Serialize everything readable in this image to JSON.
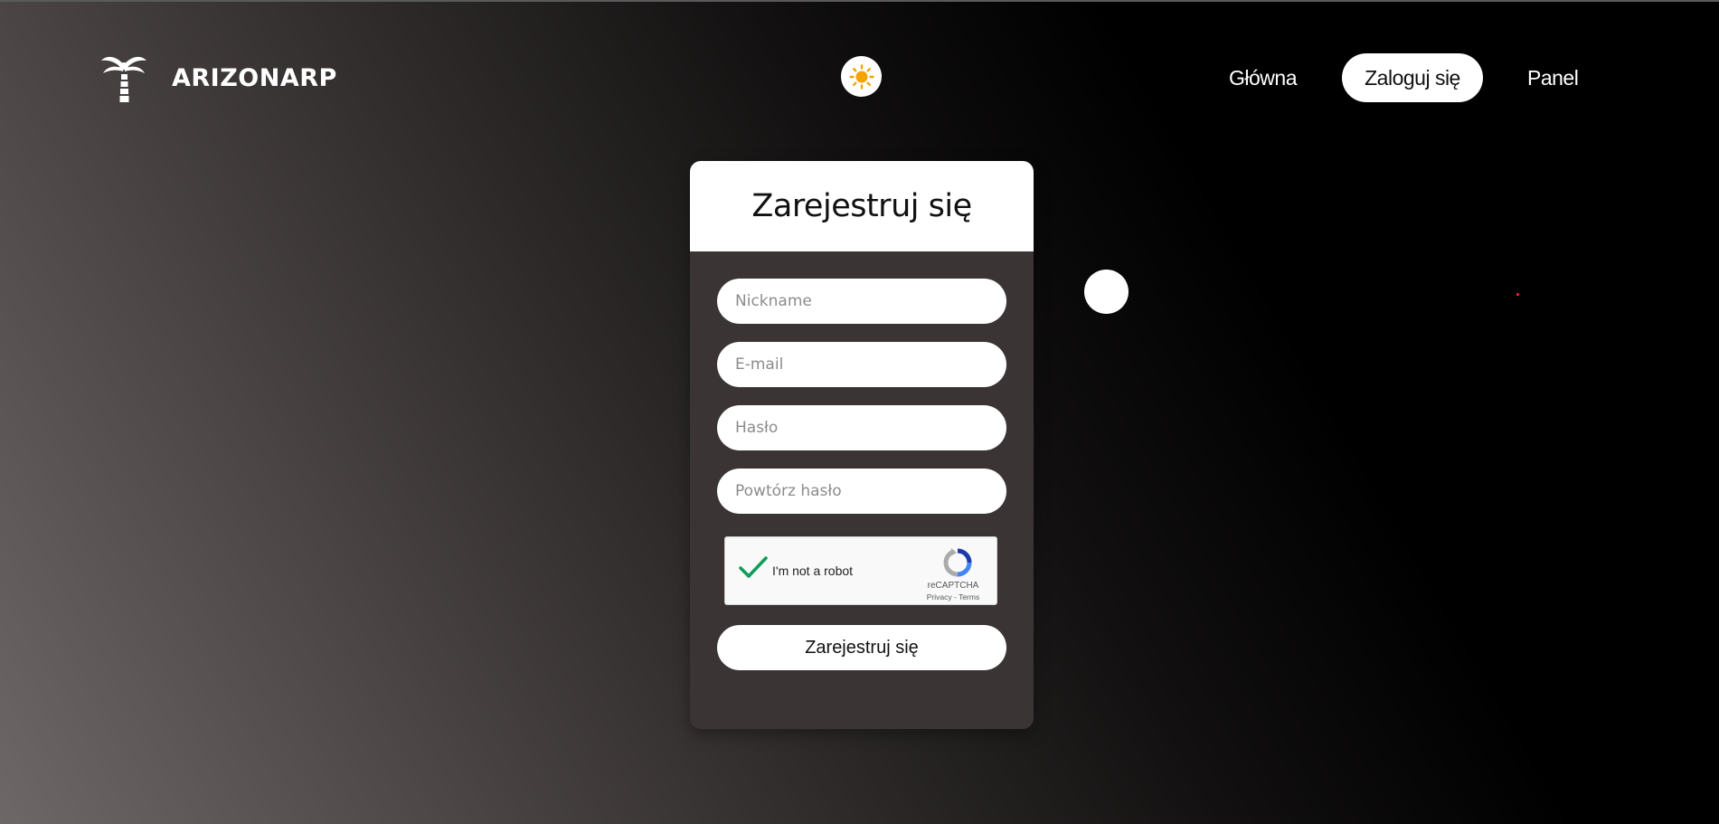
{
  "brand": {
    "name": "ARIZONARP",
    "logo_icon": "palm-tree-icon"
  },
  "theme_toggle": {
    "icon": "sun-icon",
    "color": "#f5a300"
  },
  "nav": {
    "items": [
      {
        "label": "Główna",
        "active": false
      },
      {
        "label": "Zaloguj się",
        "active": true
      },
      {
        "label": "Panel",
        "active": false
      }
    ]
  },
  "register_form": {
    "title": "Zarejestruj się",
    "fields": [
      {
        "name": "nickname",
        "placeholder": "Nickname",
        "value": ""
      },
      {
        "name": "email",
        "placeholder": "E-mail",
        "value": ""
      },
      {
        "name": "password",
        "placeholder": "Hasło",
        "value": ""
      },
      {
        "name": "password_repeat",
        "placeholder": "Powtórz hasło",
        "value": ""
      }
    ],
    "captcha": {
      "label": "I'm not a robot",
      "checked": true,
      "brand": "reCAPTCHA",
      "privacy": "Privacy",
      "separator": "-",
      "terms": "Terms",
      "check_color": "#0f9d58"
    },
    "submit_label": "Zarejestruj się"
  },
  "colors": {
    "card_background": "#3b3434",
    "accent_white": "#ffffff",
    "background_light": "#6e6767",
    "background_dark": "#000000"
  }
}
